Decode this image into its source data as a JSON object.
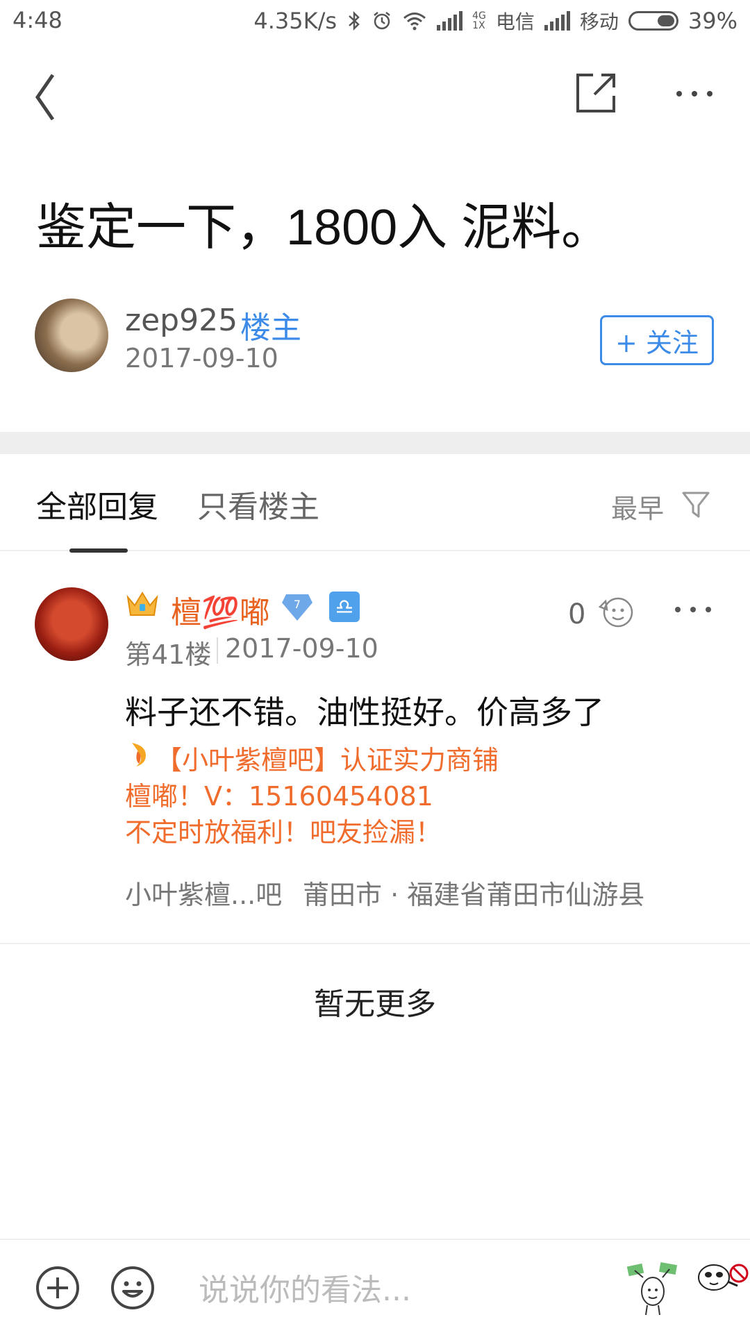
{
  "status_bar": {
    "time": "4:48",
    "speed": "4.35K/s",
    "net_badge_top": "4G",
    "net_badge_bottom": "1X",
    "carrier1": "电信",
    "carrier2": "移动",
    "battery": "39%"
  },
  "nav": {
    "back_icon": "chevron-left-icon",
    "share_icon": "share-external-icon",
    "more_icon": "more-dots-icon"
  },
  "post": {
    "title": "鉴定一下，1800入 泥料。",
    "author": "zep925",
    "author_tag": "楼主",
    "date": "2017-09-10",
    "follow_label": "+ 关注"
  },
  "tabs": {
    "all_replies": "全部回复",
    "owner_only": "只看楼主",
    "sort": "最早"
  },
  "reply": {
    "user": "檀💯嘟",
    "level": "7",
    "zodiac": "♎",
    "floor": "第41楼",
    "date": "2017-09-10",
    "likes": "0",
    "text": "料子还不错。油性挺好。价高多了",
    "signature_line1": "【小叶紫檀吧】认证实力商铺",
    "signature_line2": "檀嘟！V：15160454081",
    "signature_line3": "不定时放福利！吧友捡漏！",
    "forum": "小叶紫檀...吧",
    "location": "莆田市 · 福建省莆田市仙游县"
  },
  "footer": {
    "no_more": "暂无更多"
  },
  "bottom_bar": {
    "placeholder": "说说你的看法..."
  },
  "colors": {
    "accent_blue": "#3d8be8",
    "signature_orange": "#f06c2c",
    "divider": "#eeeeee"
  }
}
